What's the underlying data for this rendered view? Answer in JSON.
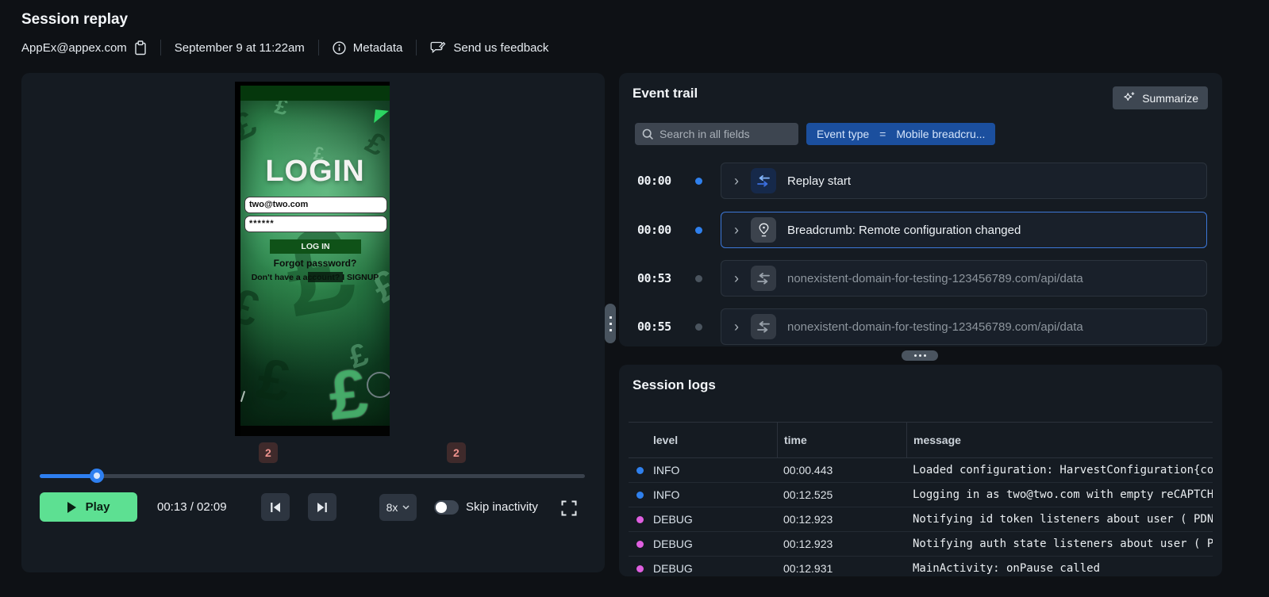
{
  "colors": {
    "accent_blue": "#2f80ed",
    "muted_dot": "#4a545e",
    "selected_border": "#3c77d8",
    "chip_blue": "#1b4f9e",
    "play_green": "#5de092",
    "marker_bg": "#3f2a2b",
    "marker_text": "#ee928d",
    "info_dot": "#2f80ed",
    "debug_dot": "#df5fe0"
  },
  "header": {
    "title": "Session replay",
    "replay_user": "AppEx@appex.com",
    "copy_icon": "clipboard-icon",
    "date": "September 9 at 11:22am",
    "metadata": {
      "icon": "info-circle-icon",
      "label": "Metadata"
    },
    "feedback": {
      "icon": "feedback-bubble-icon",
      "label": "Send us feedback"
    }
  },
  "player": {
    "video": {
      "login_title": "LOGIN",
      "email_value": "two@two.com",
      "password_value": "******",
      "login_button_label": "LOG IN",
      "forgot_password_label": "Forgot password?",
      "signup_label": "Don't have a account? I SIGNUP"
    },
    "timeline": {
      "progress_fraction": 0.105,
      "markers": [
        {
          "label": "2",
          "position_pct": 41.9
        },
        {
          "label": "2",
          "position_pct": 76.4
        }
      ]
    },
    "controls": {
      "play_label": "Play",
      "time_display": "00:13 / 02:09",
      "speed_label": "8x",
      "skip_inactivity_label": "Skip inactivity",
      "skip_inactivity_enabled": false
    }
  },
  "event_trail": {
    "title": "Event trail",
    "summarize_label": "Summarize",
    "summarize_icon": "sparkle-icon",
    "search_placeholder": "Search in all fields",
    "filter_chip": {
      "key": "Event type",
      "operator": "=",
      "value": "Mobile breadcru..."
    },
    "events": [
      {
        "time": "00:00",
        "label": "Replay start",
        "icon": "swap-arrows-icon",
        "state": "active",
        "dot_color": "#2f80ed"
      },
      {
        "time": "00:00",
        "label": "Breadcrumb: Remote configuration changed",
        "icon": "location-pin-icon",
        "state": "selected",
        "dot_color": "#2f80ed"
      },
      {
        "time": "00:53",
        "label": "nonexistent-domain-for-testing-123456789.com/api/data",
        "icon": "swap-arrows-icon",
        "state": "muted",
        "dot_color": "#4a545e"
      },
      {
        "time": "00:55",
        "label": "nonexistent-domain-for-testing-123456789.com/api/data",
        "icon": "swap-arrows-icon",
        "state": "muted",
        "dot_color": "#4a545e"
      }
    ]
  },
  "session_logs": {
    "title": "Session logs",
    "columns": [
      "level",
      "time",
      "message"
    ],
    "rows": [
      {
        "level": "INFO",
        "time": "00:00.443",
        "message": "Loaded configuration: HarvestConfiguration{col",
        "level_color": "#2f80ed"
      },
      {
        "level": "INFO",
        "time": "00:12.525",
        "message": "Logging in as two@two.com with empty reCAPTCHA",
        "level_color": "#2f80ed"
      },
      {
        "level": "DEBUG",
        "time": "00:12.923",
        "message": "Notifying id token listeners about user ( PDNl",
        "level_color": "#df5fe0"
      },
      {
        "level": "DEBUG",
        "time": "00:12.923",
        "message": "Notifying auth state listeners about user ( PD",
        "level_color": "#df5fe0"
      },
      {
        "level": "DEBUG",
        "time": "00:12.931",
        "message": "MainActivity: onPause called",
        "level_color": "#df5fe0"
      }
    ]
  }
}
